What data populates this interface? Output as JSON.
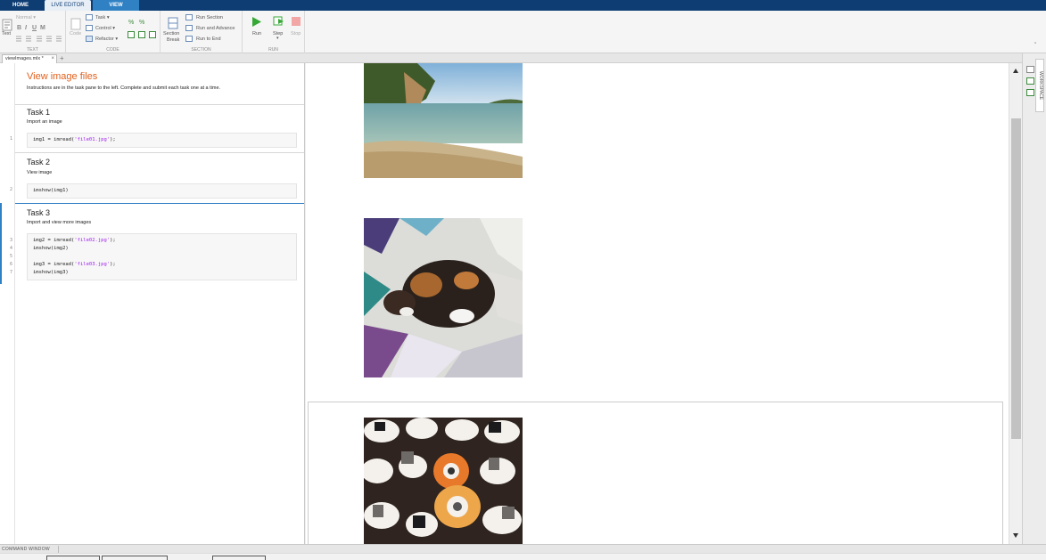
{
  "tabs": {
    "home": "HOME",
    "live_editor": "LIVE EDITOR",
    "view": "VIEW"
  },
  "toolstrip": {
    "text_group": {
      "text_label": "Text",
      "style_value": "Normal",
      "group_label": "TEXT"
    },
    "code_group": {
      "code_label": "Code",
      "task_label": "Task",
      "control_label": "Control",
      "refactor_label": "Refactor",
      "group_label": "CODE"
    },
    "section_group": {
      "section_break_label_1": "Section",
      "section_break_label_2": "Break",
      "run_section": "Run Section",
      "run_and_advance": "Run and Advance",
      "run_to_end": "Run to End",
      "group_label": "SECTION"
    },
    "run_group": {
      "run": "Run",
      "step": "Step",
      "stop": "Stop",
      "group_label": "RUN"
    }
  },
  "document_tab": {
    "name": "viewImages.mlx *"
  },
  "editor": {
    "title": "View image files",
    "instructions": "Instructions are in the task pane to the left. Complete and submit each task one at a time.",
    "tasks": [
      {
        "title": "Task 1",
        "subtitle": "Import an image"
      },
      {
        "title": "Task 2",
        "subtitle": "View image"
      },
      {
        "title": "Task 3",
        "subtitle": "Import and view more images"
      }
    ],
    "line_numbers": [
      "1",
      "2",
      "3",
      "4",
      "5",
      "6",
      "7"
    ],
    "code": {
      "l1_pre": "img1 = imread(",
      "l1_str": "'file01.jpg'",
      "l1_post": ");",
      "l2": "imshow(img1)",
      "l3_pre": "img2 = imread(",
      "l3_str": "'file02.jpg'",
      "l3_post": ");",
      "l4": "imshow(img2)",
      "l5": "",
      "l6_pre": "img3 = imread(",
      "l6_str": "'file03.jpg'",
      "l6_post": ");",
      "l7": "imshow(img3)"
    }
  },
  "right_panel": {
    "label": "WORKSPACE"
  },
  "command_window": {
    "label": "COMMAND WINDOW"
  },
  "colors": {
    "accent": "#2f81c4",
    "title": "#e0601c",
    "string": "#a020f0",
    "tabbar": "#0e3d73"
  }
}
